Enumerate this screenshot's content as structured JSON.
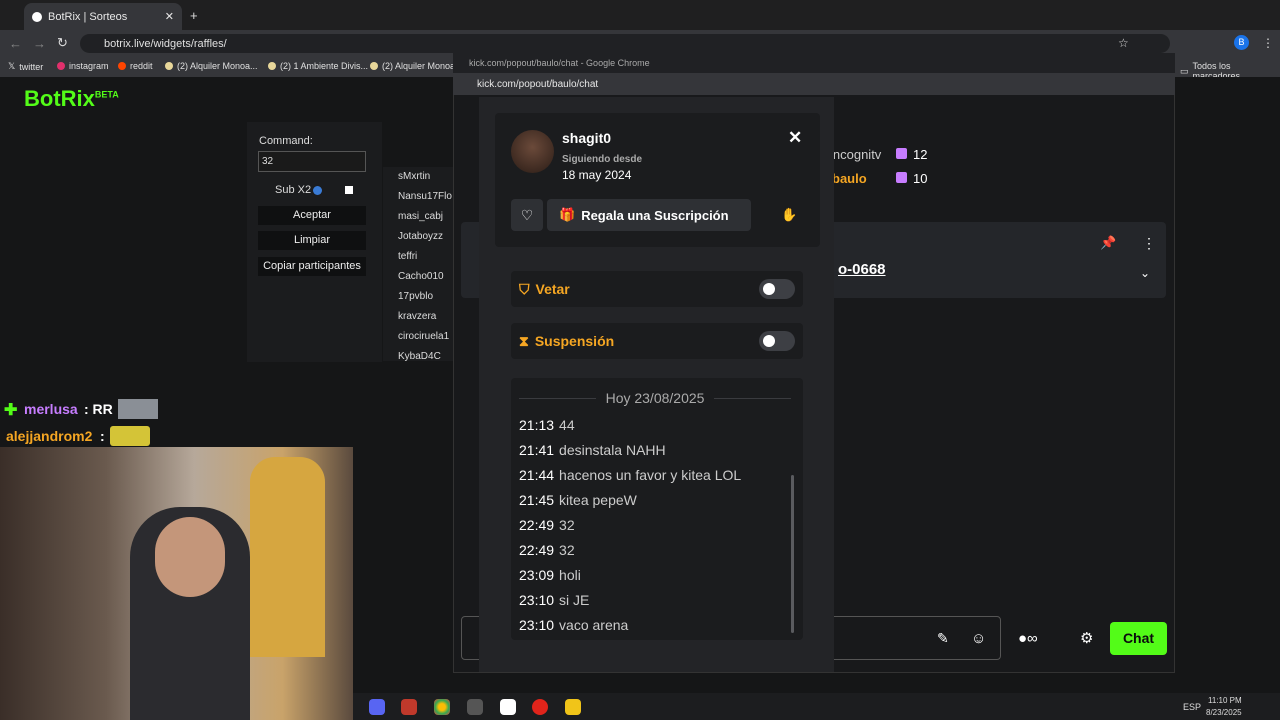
{
  "browser": {
    "tab_title": "BotRix | Sorteos",
    "url": "botrix.live/widgets/raffles/",
    "bookmarks": [
      "twitter",
      "instagram",
      "reddit",
      "(2) Alquiler Monoa...",
      "(2) 1 Ambiente Divis...",
      "(2) Alquiler Monoa"
    ],
    "bookmarks_folder": "Todos los marcadores"
  },
  "botrix": {
    "logo": "BotRix",
    "badge": "BETA",
    "command_label": "Command:",
    "command_value": "32",
    "sub_label": "Sub X2",
    "accept": "Aceptar",
    "clear": "Limpiar",
    "copy": "Copiar participantes",
    "participants": [
      "sMxrtin",
      "Nansu17Flo",
      "masi_cabj",
      "Jotaboyzz",
      "teffri",
      "Cacho010",
      "17pvblo",
      "kravzera",
      "cirociruela1",
      "KybaD4C"
    ]
  },
  "overlay": {
    "user1": "merlusa",
    "msg1": ": RR",
    "user2": "alejjandrom2",
    "msg2": ":"
  },
  "popup": {
    "window_title": "kick.com/popout/baulo/chat - Google Chrome",
    "url": "kick.com/popout/baulo/chat",
    "leaderboard": [
      {
        "name": "incognitv",
        "count": "12"
      },
      {
        "name": "baulo",
        "count": "10"
      }
    ],
    "pinned_code": "o-0668",
    "chat_button": "Chat"
  },
  "usercard": {
    "username": "shagit0",
    "following_label": "Siguiendo desde",
    "following_date": "18 may 2024",
    "gift_button": "Regala una Suscripción",
    "veto_label": "Vetar",
    "suspend_label": "Suspensión",
    "date_separator": "Hoy 23/08/2025",
    "messages": [
      {
        "time": "21:13",
        "text": "44"
      },
      {
        "time": "21:41",
        "text": "desinstala NAHH"
      },
      {
        "time": "21:44",
        "text": "hacenos un favor y kitea LOL"
      },
      {
        "time": "21:45",
        "text": "kitea pepeW"
      },
      {
        "time": "22:49",
        "text": "32"
      },
      {
        "time": "22:49",
        "text": "32"
      },
      {
        "time": "23:09",
        "text": "holi"
      },
      {
        "time": "23:10",
        "text": "si JE"
      },
      {
        "time": "23:10",
        "text": "vaco arena"
      }
    ]
  },
  "taskbar": {
    "lang": "ESP",
    "time": "11:10 PM",
    "date": "8/23/2025"
  },
  "colors": {
    "kick_green": "#53fc18",
    "mod_orange": "#f5a623"
  }
}
